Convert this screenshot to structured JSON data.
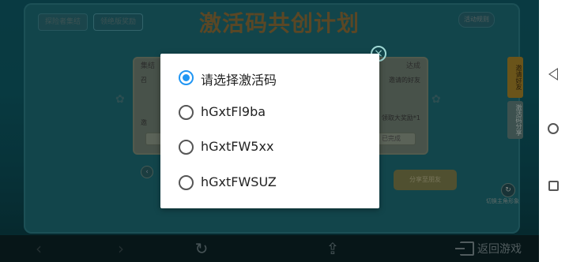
{
  "game": {
    "tabs": [
      "探险者集结",
      "领绝版奖励"
    ],
    "title": "激活码共创计划",
    "corner_button": "活动规则",
    "left_panel": {
      "title": "集结",
      "line1": "召",
      "line2": "邀",
      "button": ""
    },
    "right_panel": {
      "title": "达成",
      "line1": "邀请的好友",
      "line2": "领取大奖励*1",
      "button": "已完成"
    },
    "side_tabs": [
      "邀请好友",
      "激活码分享"
    ],
    "foot_button": "分享至朋友",
    "hero_note": "切换主角形象"
  },
  "toolbar": {
    "back_icon": "‹",
    "forward_icon": "›",
    "reload_icon": "↻",
    "share_icon": "⇪",
    "exit_label": "返回游戏"
  },
  "dialog": {
    "options": [
      {
        "label": "请选择激活码",
        "selected": true
      },
      {
        "label": "hGxtFl9ba",
        "selected": false
      },
      {
        "label": "hGxtFW5xx",
        "selected": false
      },
      {
        "label": "hGxtFWSUZ",
        "selected": false
      }
    ],
    "close_glyph": "×"
  },
  "colors": {
    "accent": "#2196f3",
    "dialog_bg": "#ffffff",
    "backdrop": "#0f5a66"
  }
}
